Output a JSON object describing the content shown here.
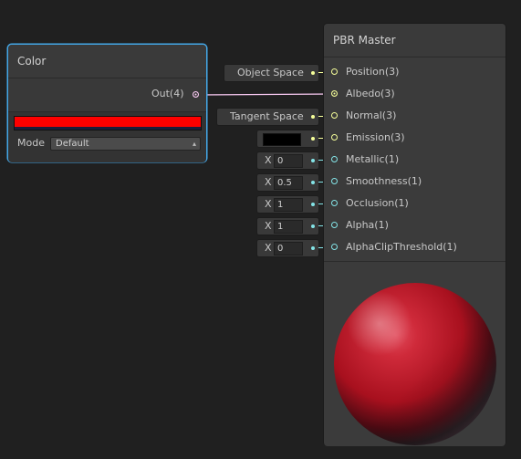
{
  "color_node": {
    "title": "Color",
    "output_label": "Out(4)",
    "swatch_color": "#ff0000",
    "mode_label": "Mode",
    "mode_value": "Default"
  },
  "pbr_master": {
    "title": "PBR Master",
    "slots": [
      {
        "label": "Position(3)"
      },
      {
        "label": "Albedo(3)"
      },
      {
        "label": "Normal(3)"
      },
      {
        "label": "Emission(3)"
      },
      {
        "label": "Metallic(1)"
      },
      {
        "label": "Smoothness(1)"
      },
      {
        "label": "Occlusion(1)"
      },
      {
        "label": "Alpha(1)"
      },
      {
        "label": "AlphaClipThreshold(1)"
      }
    ]
  },
  "inputs": {
    "position_space": "Object Space",
    "normal_space": "Tangent Space",
    "emission_color": "#000000",
    "axis_label": "X",
    "metallic": "0",
    "smoothness": "0.5",
    "occlusion": "1",
    "alpha": "1",
    "alpha_clip": "0"
  },
  "colors": {
    "vec3_port": "#f6ff9a",
    "vec1_port": "#84e4e7",
    "vec4_port": "#fbcbf4",
    "selection": "#44a8e8"
  }
}
